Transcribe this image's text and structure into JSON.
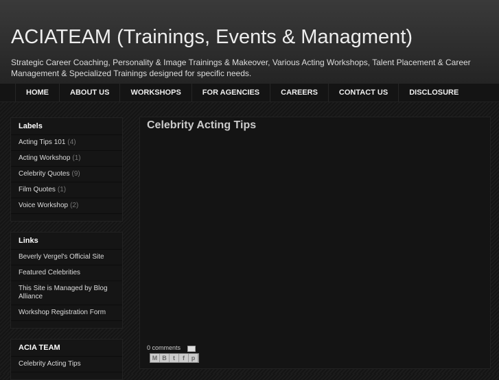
{
  "header": {
    "title": "ACIATEAM (Trainings, Events & Managment)",
    "description": "Strategic Career Coaching, Personality & Image Trainings & Makeover, Various Acting Workshops, Talent Placement & Career Management & Specialized Trainings designed for specific needs."
  },
  "nav": [
    "HOME",
    "ABOUT US",
    "WORKSHOPS",
    "FOR AGENCIES",
    "CAREERS",
    "CONTACT US",
    "DISCLOSURE"
  ],
  "labels": {
    "title": "Labels",
    "items": [
      {
        "label": "Acting Tips 101",
        "count": "(4)"
      },
      {
        "label": "Acting Workshop",
        "count": "(1)"
      },
      {
        "label": "Celebrity Quotes",
        "count": "(9)"
      },
      {
        "label": "Film Quotes",
        "count": "(1)"
      },
      {
        "label": "Voice Workshop",
        "count": "(2)"
      }
    ]
  },
  "links": {
    "title": "Links",
    "items": [
      "Beverly Vergel's Official Site",
      "Featured Celebrities",
      "This Site is Managed by Blog Alliance",
      "Workshop Registration Form"
    ]
  },
  "team": {
    "title": "ACIA TEAM",
    "items": [
      "Celebrity Acting Tips"
    ]
  },
  "post": {
    "title": "Celebrity Acting Tips",
    "comments": "0 comments",
    "share_icons": [
      "M",
      "B",
      "t",
      "f",
      "p"
    ]
  }
}
